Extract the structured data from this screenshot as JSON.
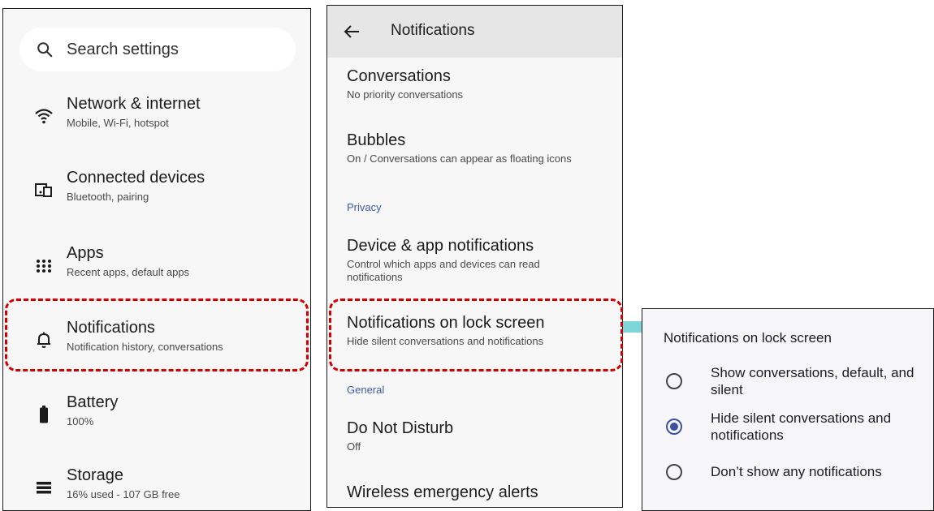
{
  "settings": {
    "search_placeholder": "Search settings",
    "items": [
      {
        "title": "Network & internet",
        "subtitle": "Mobile, Wi-Fi, hotspot",
        "icon": "wifi-icon"
      },
      {
        "title": "Connected devices",
        "subtitle": "Bluetooth, pairing",
        "icon": "devices-icon"
      },
      {
        "title": "Apps",
        "subtitle": "Recent apps, default apps",
        "icon": "apps-grid-icon"
      },
      {
        "title": "Notifications",
        "subtitle": "Notification history, conversations",
        "icon": "bell-icon"
      },
      {
        "title": "Battery",
        "subtitle": "100%",
        "icon": "battery-icon"
      },
      {
        "title": "Storage",
        "subtitle": "16% used - 107 GB free",
        "icon": "storage-icon"
      }
    ]
  },
  "notifications_page": {
    "title": "Notifications",
    "items": [
      {
        "title": "Conversations",
        "subtitle": "No priority conversations"
      },
      {
        "title": "Bubbles",
        "subtitle": "On / Conversations can appear as floating icons"
      },
      {
        "section": "Privacy"
      },
      {
        "title": "Device & app notifications",
        "subtitle": "Control which apps and devices can read notifications"
      },
      {
        "title": "Notifications on lock screen",
        "subtitle": "Hide silent conversations and notifications"
      },
      {
        "section": "General"
      },
      {
        "title": "Do Not Disturb",
        "subtitle": "Off"
      },
      {
        "title": "Wireless emergency alerts",
        "subtitle": ""
      }
    ]
  },
  "lock_screen_dialog": {
    "title": "Notifications on lock screen",
    "options": [
      {
        "label": "Show conversations, default, and silent",
        "selected": false
      },
      {
        "label": "Hide silent conversations and notifications",
        "selected": true
      },
      {
        "label": "Don’t show any notifications",
        "selected": false
      }
    ]
  },
  "colors": {
    "highlight": "#d40000",
    "arrow": "#7ed6d8",
    "radio_selected": "#3f51a5",
    "section": "#3d5fa0"
  }
}
